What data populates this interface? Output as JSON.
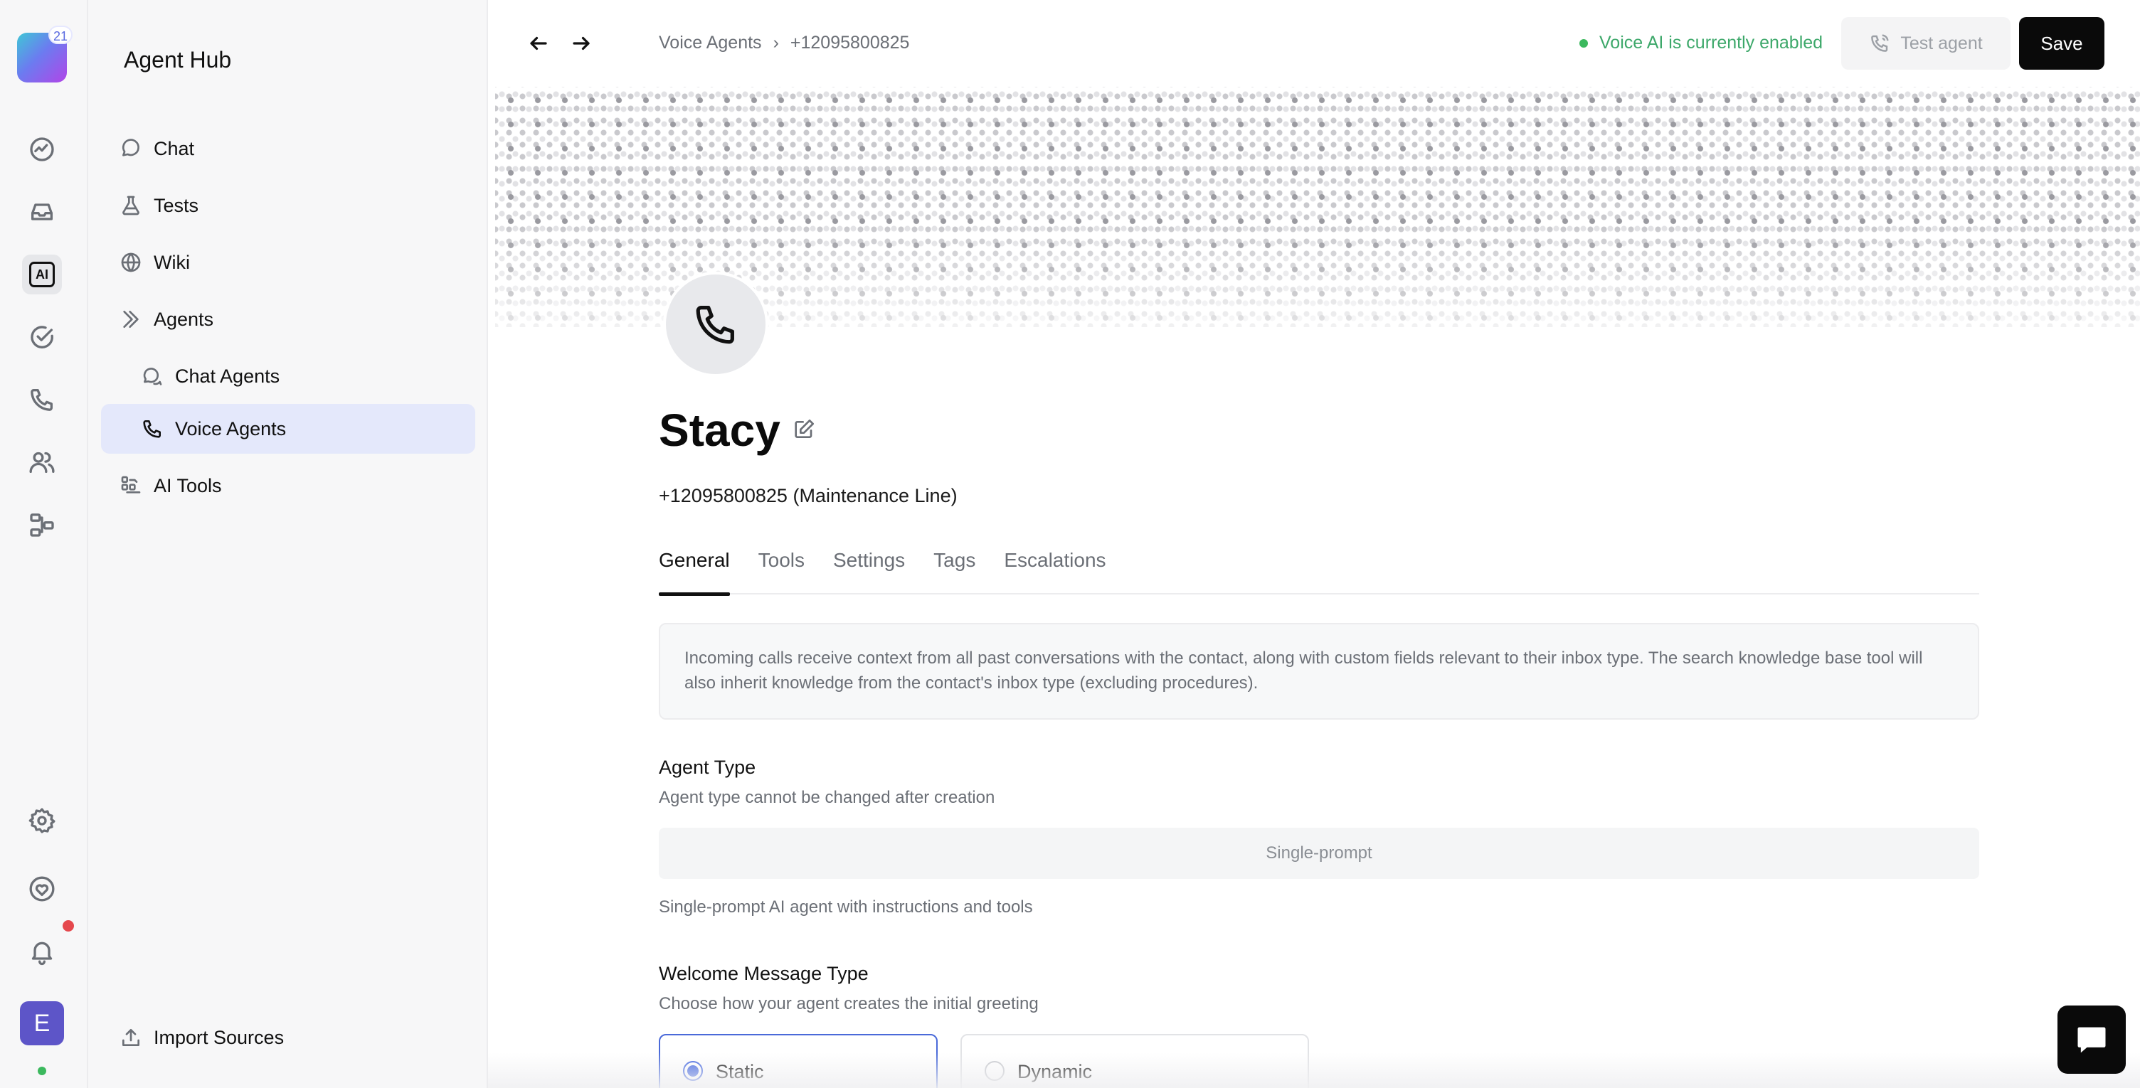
{
  "rail": {
    "logo_badge": "21",
    "items": [
      "activity-icon",
      "inbox-icon",
      "ai-icon",
      "check-circle-icon",
      "phone-icon",
      "users-icon",
      "workflow-icon"
    ],
    "ai_label": "AI",
    "bottom_items": [
      "gear-icon",
      "heart-icon",
      "bell-icon"
    ],
    "avatar_initial": "E"
  },
  "sidebar": {
    "title": "Agent Hub",
    "items": [
      {
        "label": "Chat",
        "icon": "chat-bubble-icon"
      },
      {
        "label": "Tests",
        "icon": "flask-icon"
      },
      {
        "label": "Wiki",
        "icon": "globe-icon"
      },
      {
        "label": "Agents",
        "icon": "chevrons-right-icon"
      },
      {
        "label": "Chat Agents",
        "icon": "chat-bubbles-icon"
      },
      {
        "label": "Voice Agents",
        "icon": "phone-icon",
        "active": true
      },
      {
        "label": "AI Tools",
        "icon": "tools-grid-icon"
      }
    ],
    "import_label": "Import Sources"
  },
  "topbar": {
    "breadcrumb": [
      "Voice Agents",
      "›",
      "+12095800825"
    ],
    "status_text": "Voice AI is currently enabled",
    "test_label": "Test agent",
    "save_label": "Save"
  },
  "agent": {
    "name": "Stacy",
    "subtitle": "+12095800825 (Maintenance Line)"
  },
  "tabs": [
    "General",
    "Tools",
    "Settings",
    "Tags",
    "Escalations"
  ],
  "active_tab": "General",
  "info_text": "Incoming calls receive context from all past conversations with the contact, along with custom fields relevant to their inbox type. The search knowledge base tool will also inherit knowledge from the contact's inbox type (excluding procedures).",
  "agent_type": {
    "title": "Agent Type",
    "desc": "Agent type cannot be changed after creation",
    "value": "Single-prompt",
    "help": "Single-prompt AI agent with instructions and tools"
  },
  "welcome": {
    "title": "Welcome Message Type",
    "desc": "Choose how your agent creates the initial greeting",
    "options": [
      {
        "label": "Static",
        "selected": true
      },
      {
        "label": "Dynamic",
        "selected": false
      }
    ]
  },
  "colors": {
    "accent": "#3f63e0",
    "status_green": "#3da86a",
    "active_nav_bg": "#e4e8fb",
    "save_bg": "#0a0a0a"
  }
}
